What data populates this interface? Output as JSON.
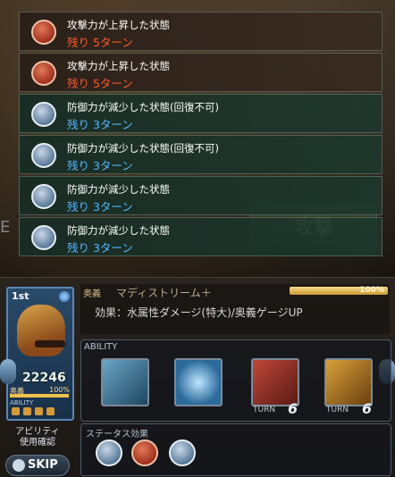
{
  "background": {
    "attack_label": "攻撃",
    "left_label": "E"
  },
  "status_effects": [
    {
      "type": "atk-up",
      "title": "攻撃力が上昇した状態",
      "remaining": "残り 5ターン",
      "color": "#ff5a2a",
      "icon": "sword-up-icon"
    },
    {
      "type": "atk-up",
      "title": "攻撃力が上昇した状態",
      "remaining": "残り 5ターン",
      "color": "#ff5a2a",
      "icon": "sword-up-icon"
    },
    {
      "type": "def-down",
      "title": "防御力が減少した状態(回復不可)",
      "remaining": "残り 3ターン",
      "color": "#55b6ff",
      "icon": "shield-down-icon"
    },
    {
      "type": "def-down",
      "title": "防御力が減少した状態(回復不可)",
      "remaining": "残り 3ターン",
      "color": "#55b6ff",
      "icon": "shield-down-icon"
    },
    {
      "type": "def-down",
      "title": "防御力が減少した状態",
      "remaining": "残り 3ターン",
      "color": "#55b6ff",
      "icon": "shield-down-icon"
    },
    {
      "type": "def-down",
      "title": "防御力が減少した状態",
      "remaining": "残り 3ターン",
      "color": "#55b6ff",
      "icon": "shield-down-icon"
    }
  ],
  "character": {
    "rank": "1st",
    "hp": "22246",
    "ougi_label": "奥義",
    "ougi_percent": "100%",
    "ability_label": "ABILITY"
  },
  "ougi": {
    "tag": "奥義",
    "name": "マディストリーム＋",
    "gauge": "100%",
    "effect": "効果：水属性ダメージ(特大)/奥義ゲージUP"
  },
  "abilities": {
    "header": "ABILITY",
    "slots": [
      {
        "icon": "water-attack-icon",
        "turn_label": "",
        "turns": ""
      },
      {
        "icon": "shield-buff-icon",
        "turn_label": "",
        "turns": ""
      },
      {
        "icon": "axe-icon",
        "turn_label": "TURN",
        "turns": "6"
      },
      {
        "icon": "lance-icon",
        "turn_label": "TURN",
        "turns": "6"
      }
    ]
  },
  "controls": {
    "confirm_line1": "アビリティ",
    "confirm_line2": "使用確認",
    "skip_label": "SKIP"
  },
  "status_panel": {
    "header": "ステータス効果",
    "icons": [
      "shield-down-icon",
      "sword-up-icon",
      "shield-down-icon"
    ]
  },
  "colors": {
    "buff_text": "#ff5a2a",
    "debuff_text": "#55b6ff"
  }
}
